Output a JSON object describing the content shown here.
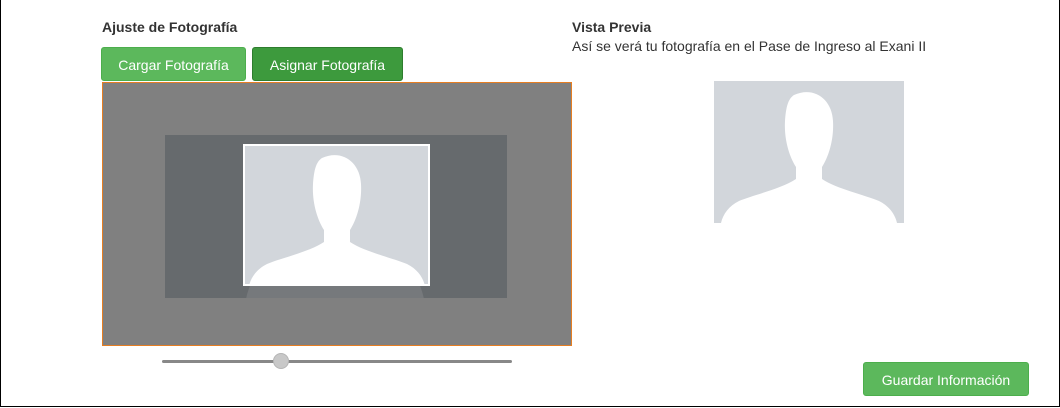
{
  "left_panel": {
    "title": "Ajuste de Fotografía",
    "upload_button_label": "Cargar Fotografía",
    "assign_button_label": "Asignar Fotografía"
  },
  "right_panel": {
    "title": "Vista Previa",
    "subtitle": "Así se verá tu fotografía en el Pase de Ingreso al Exani II"
  },
  "zoom_slider": {
    "value": 0.34
  },
  "footer": {
    "save_button_label": "Guardar Información"
  },
  "colors": {
    "button_green": "#5cb85c",
    "button_green_active": "#3d9a3d",
    "cropper_border": "#e67e22",
    "placeholder_background": "#d2d6db",
    "silhouette": "#ffffff"
  },
  "icons": {
    "placeholder": "person-silhouette-icon"
  }
}
